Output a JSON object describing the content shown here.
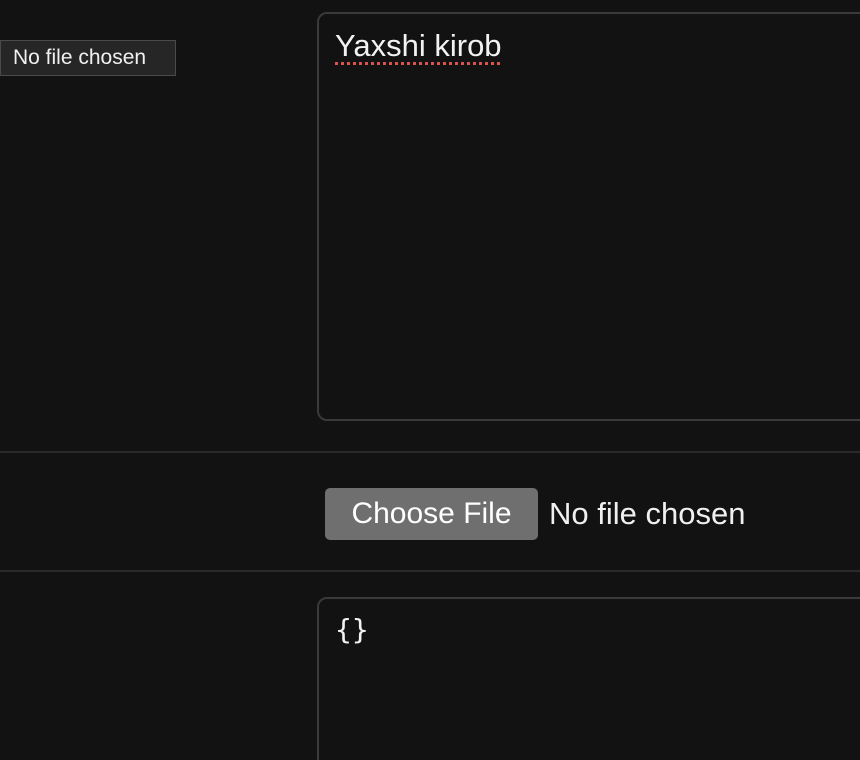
{
  "tooltip": {
    "text": "No file chosen"
  },
  "description_field": {
    "value": "Yaxshi kirob"
  },
  "file_input": {
    "button_label": "Choose File",
    "status": "No file chosen"
  },
  "json_field": {
    "value": "{}"
  },
  "colors": {
    "background": "#121212",
    "field_border": "#3a3a3a",
    "button_bg": "#6f6f6f",
    "spellcheck_underline": "#d9534f"
  }
}
